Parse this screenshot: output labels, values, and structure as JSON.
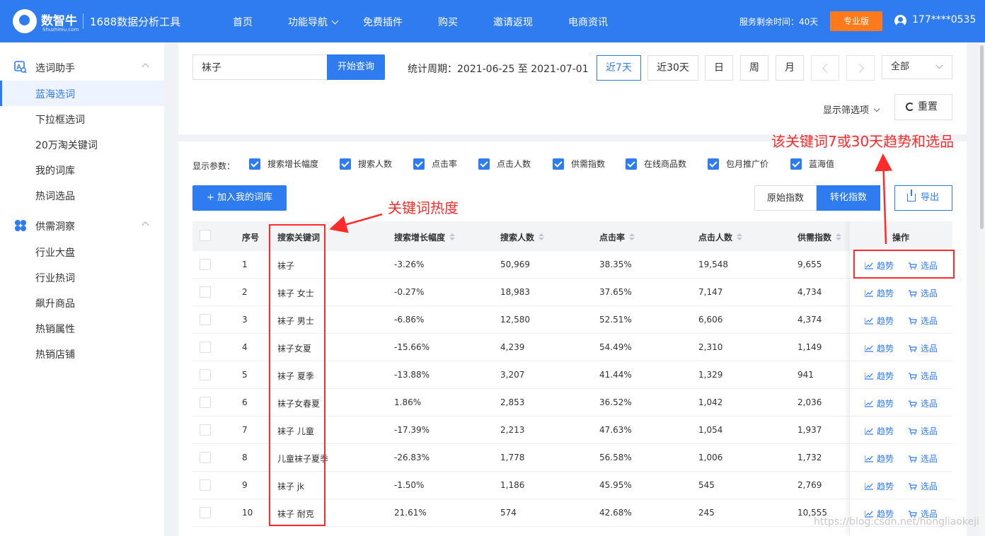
{
  "header": {
    "brand": "数智牛",
    "brand_sub": "Shuzhiniu.com",
    "tool_name": "1688数据分析工具",
    "nav": [
      {
        "label": "首页"
      },
      {
        "label": "功能导航",
        "has_dropdown": true
      },
      {
        "label": "免费插件"
      },
      {
        "label": "购买"
      },
      {
        "label": "邀请返现"
      },
      {
        "label": "电商资讯"
      }
    ],
    "service_remaining": "服务剩余时间：40天",
    "plan_button": "专业版",
    "user": "177****0535"
  },
  "sidebar": {
    "sections": [
      {
        "label": "选词助手",
        "icon": "keyword-tool-icon",
        "expanded": true,
        "items": [
          {
            "label": "蓝海选词",
            "active": true
          },
          {
            "label": "下拉框选词"
          },
          {
            "label": "20万淘关键词"
          },
          {
            "label": "我的词库"
          },
          {
            "label": "热词选品"
          }
        ]
      },
      {
        "label": "供需洞察",
        "icon": "grid-clover-icon",
        "expanded": true,
        "items": [
          {
            "label": "行业大盘"
          },
          {
            "label": "行业热词"
          },
          {
            "label": "飙升商品"
          },
          {
            "label": "热销属性"
          },
          {
            "label": "热销店铺"
          }
        ]
      }
    ]
  },
  "search": {
    "value": "袜子",
    "button": "开始查询",
    "period": "统计周期：2021-06-25 至 2021-07-01",
    "periods": [
      {
        "label": "近7天",
        "active": true
      },
      {
        "label": "近30天"
      },
      {
        "label": "日"
      },
      {
        "label": "周"
      },
      {
        "label": "月"
      }
    ],
    "scope": "全部",
    "filter_toggle": "显示筛选项",
    "reset": "重置"
  },
  "params": {
    "label": "显示参数：",
    "items": [
      "搜索增长幅度",
      "搜索人数",
      "点击率",
      "点击人数",
      "供需指数",
      "在线商品数",
      "包月推广价",
      "蓝海值"
    ]
  },
  "toolbar": {
    "add": "+ 加入我的词库",
    "raw_index": "原始指数",
    "converted_index": "转化指数",
    "export": "导出"
  },
  "table": {
    "headers": {
      "index": "序号",
      "keyword": "搜索关键词",
      "growth": "搜索增长幅度",
      "searchers": "搜索人数",
      "ctr": "点击率",
      "clickers": "点击人数",
      "supply_demand": "供需指数",
      "ops": "操作"
    },
    "action_trend": "趋势",
    "action_select": "选品",
    "rows": [
      {
        "no": "1",
        "kw": "袜子",
        "growth": "-3.26%",
        "search": "50,969",
        "ctr": "38.35%",
        "clicks": "19,548",
        "sd": "9,655"
      },
      {
        "no": "2",
        "kw": "袜子 女士",
        "growth": "-0.27%",
        "search": "18,983",
        "ctr": "37.65%",
        "clicks": "7,147",
        "sd": "4,734"
      },
      {
        "no": "3",
        "kw": "袜子 男士",
        "growth": "-6.86%",
        "search": "12,580",
        "ctr": "52.51%",
        "clicks": "6,606",
        "sd": "4,374"
      },
      {
        "no": "4",
        "kw": "袜子女夏",
        "growth": "-15.66%",
        "search": "4,239",
        "ctr": "54.49%",
        "clicks": "2,310",
        "sd": "1,149"
      },
      {
        "no": "5",
        "kw": "袜子 夏季",
        "growth": "-13.88%",
        "search": "3,207",
        "ctr": "41.44%",
        "clicks": "1,329",
        "sd": "941"
      },
      {
        "no": "6",
        "kw": "袜子女春夏",
        "growth": "1.86%",
        "search": "2,853",
        "ctr": "36.52%",
        "clicks": "1,042",
        "sd": "2,036"
      },
      {
        "no": "7",
        "kw": "袜子 儿童",
        "growth": "-17.39%",
        "search": "2,213",
        "ctr": "47.63%",
        "clicks": "1,054",
        "sd": "1,937"
      },
      {
        "no": "8",
        "kw": "儿童袜子夏季",
        "growth": "-26.83%",
        "search": "1,778",
        "ctr": "56.58%",
        "clicks": "1,006",
        "sd": "1,732"
      },
      {
        "no": "9",
        "kw": "袜子 jk",
        "growth": "-1.50%",
        "search": "1,186",
        "ctr": "45.95%",
        "clicks": "545",
        "sd": "2,769"
      },
      {
        "no": "10",
        "kw": "袜子 耐克",
        "growth": "21.61%",
        "search": "574",
        "ctr": "42.68%",
        "clicks": "245",
        "sd": "10,555"
      }
    ]
  },
  "annotations": {
    "keyword_heat": "关键词热度",
    "trend_and_select": "该关键词7或30天趋势和选品",
    "color": "#ff2b2b"
  },
  "watermark": "https://blog.csdn.net/hongliaokeji",
  "colors": {
    "primary": "#2f7bf0",
    "accent": "#ff7a1a"
  }
}
